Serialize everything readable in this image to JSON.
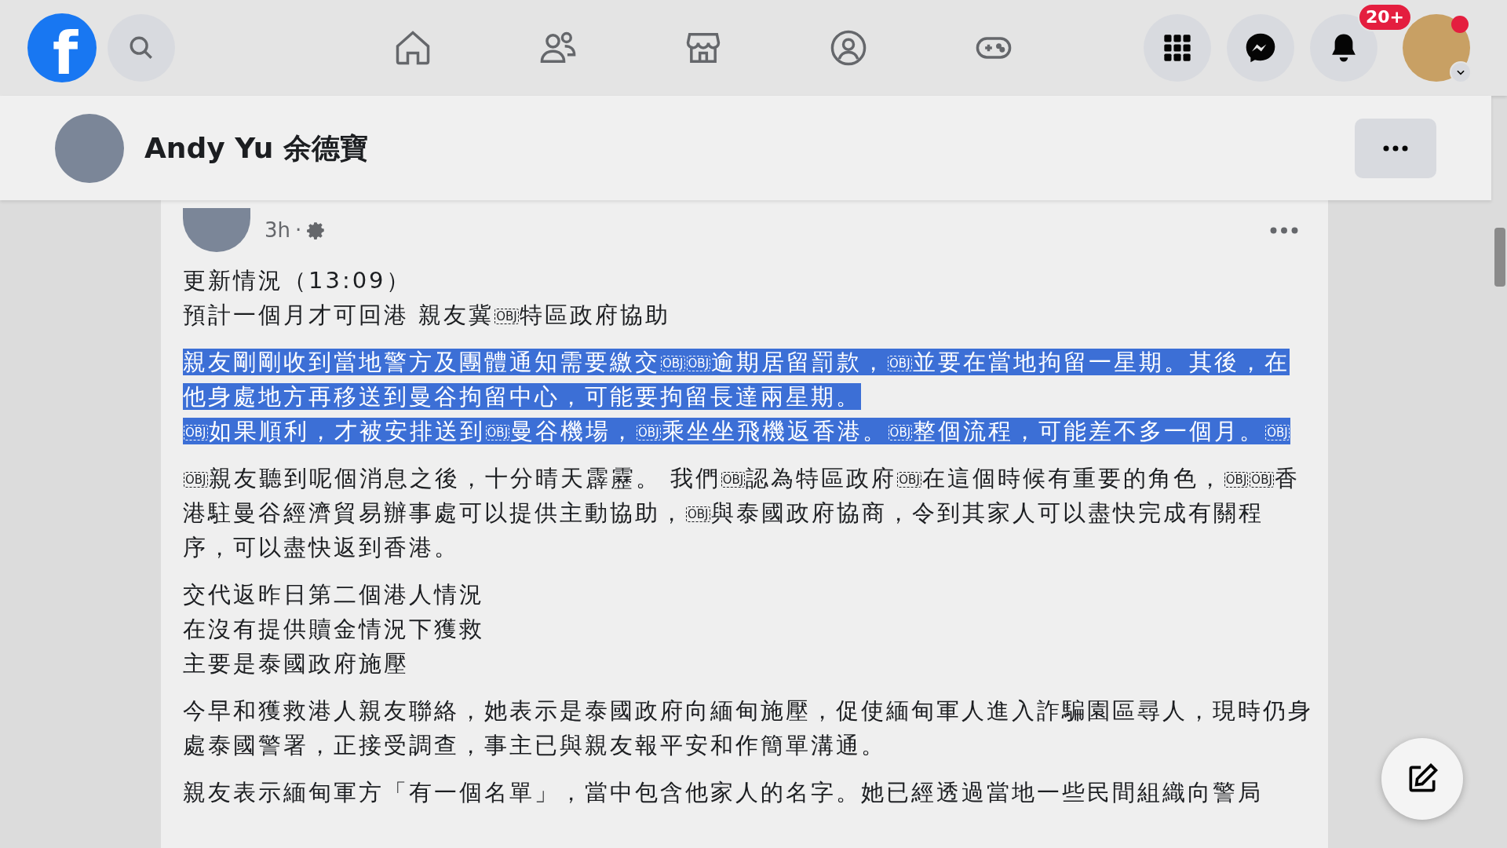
{
  "topbar": {
    "logo": "f",
    "tabs": [
      {
        "kind": "home"
      },
      {
        "kind": "friends"
      },
      {
        "kind": "marketplace"
      },
      {
        "kind": "groups"
      },
      {
        "kind": "gaming"
      }
    ],
    "actions": [
      {
        "kind": "menu"
      },
      {
        "kind": "messenger"
      },
      {
        "kind": "notifications"
      }
    ],
    "notification_badge": "20+"
  },
  "profile_header": {
    "name": "Andy Yu 余德寶"
  },
  "post": {
    "time": "3h",
    "separator": "·",
    "paragraphs": [
      {
        "selected": false,
        "lines": [
          [
            "更新情況（13:09）"
          ],
          [
            "預計一個月才可回港 親友冀",
            {
              "kind": "object_mark",
              "label": "OBJ"
            },
            "特區政府協助"
          ]
        ]
      },
      {
        "selected": true,
        "lines": [
          [
            "親友剛剛收到當地警方及團體通知需要繳交",
            {
              "kind": "object_mark",
              "label": "OBJ"
            },
            {
              "kind": "object_mark",
              "label": "OBJ"
            },
            "逾期居留罰款，",
            {
              "kind": "object_mark",
              "label": "OBJ"
            },
            "並要在當地拘留一星期。其後，在他身處地方再移送到曼谷拘留中心，可能要拘留長達兩星期。"
          ],
          [
            {
              "kind": "object_mark",
              "label": "OBJ"
            },
            "如果順利，才被安排送到",
            {
              "kind": "object_mark",
              "label": "OBJ"
            },
            "曼谷機場，",
            {
              "kind": "object_mark",
              "label": "OBJ"
            },
            "乘坐坐飛機返香港。",
            {
              "kind": "object_mark",
              "label": "OBJ"
            },
            "整個流程，可能差不多一個月。",
            {
              "kind": "object_mark",
              "label": "OBJ"
            }
          ]
        ]
      },
      {
        "selected": false,
        "lines": [
          [
            {
              "kind": "object_mark",
              "label": "OBJ"
            },
            "親友聽到呢個消息之後，十分晴天霹靂。 我們",
            {
              "kind": "object_mark",
              "label": "OBJ"
            },
            "認為特區政府",
            {
              "kind": "object_mark",
              "label": "OBJ"
            },
            "在這個時候有重要的角色，",
            {
              "kind": "object_mark",
              "label": "OBJ"
            },
            {
              "kind": "object_mark",
              "label": "OBJ"
            },
            "香港駐曼谷經濟貿易辦事處可以提供主動協助，",
            {
              "kind": "object_mark",
              "label": "OBJ"
            },
            "與泰國政府協商，令到其家人可以盡快完成有關程序，可以盡快返到香港。"
          ]
        ]
      },
      {
        "selected": false,
        "lines": [
          [
            "交代返昨日第二個港人情況"
          ],
          [
            "在沒有提供贖金情況下獲救"
          ],
          [
            "主要是泰國政府施壓"
          ]
        ]
      },
      {
        "selected": false,
        "lines": [
          [
            "今早和獲救港人親友聯絡，她表示是泰國政府向緬甸施壓，促使緬甸軍人進入詐騙園區尋人，現時仍身處泰國警署，正接受調查，事主已與親友報平安和作簡單溝通。"
          ]
        ]
      },
      {
        "selected": false,
        "lines": [
          [
            "親友表示緬甸軍方「有一個名單」，當中包含他家人的名字。她已經透過當地一些民間組織向警局"
          ]
        ]
      }
    ]
  }
}
